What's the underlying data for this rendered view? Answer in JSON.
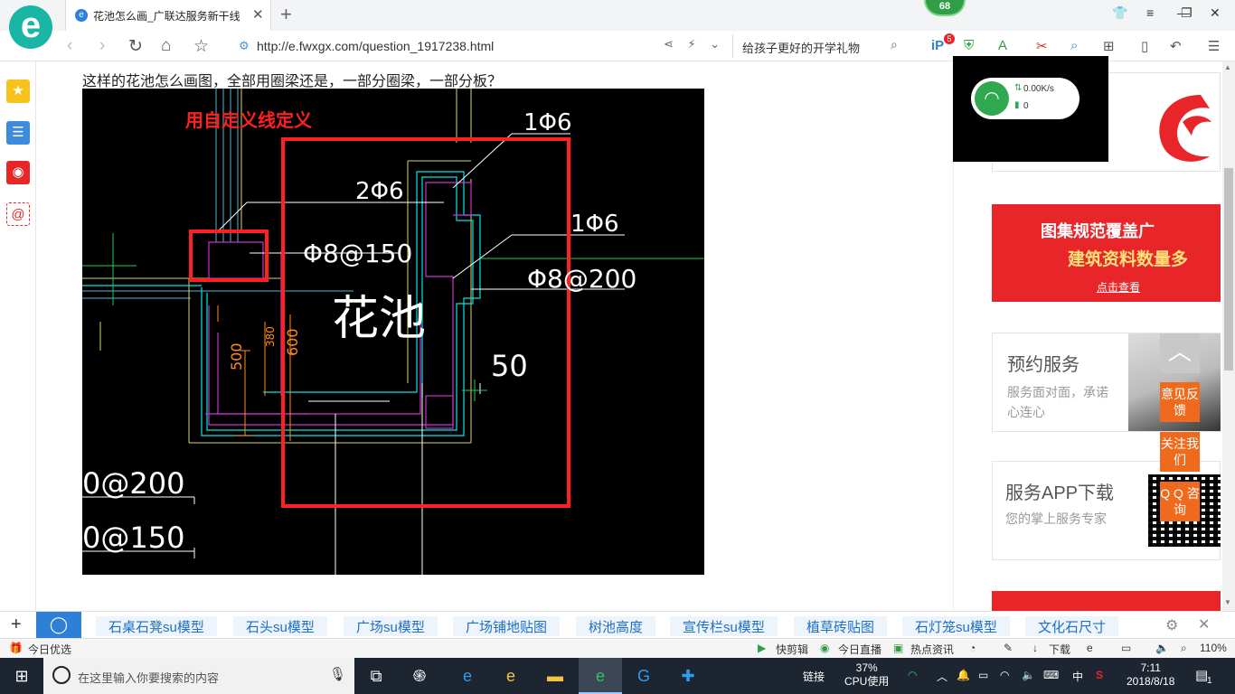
{
  "browser": {
    "tab_title": "花池怎么画_广联达服务新干线",
    "tab_favicon": "e",
    "logo_letter": "e",
    "badge_count": "68",
    "url": "http://e.fwxgx.com/question_1917238.html",
    "search_text": "给孩子更好的开学礼物",
    "extension_badge": "5"
  },
  "question": {
    "text": "这样的花池怎么画图，全部用圈梁还是，一部分圈梁，一部分板？"
  },
  "cad_drawing": {
    "annotation_red": "用自定义线定义",
    "label_1phi6_top": "1Φ6",
    "label_2phi6": "2Φ6",
    "label_1phi6_right": "1Φ6",
    "label_phi8_150": "Φ8@150",
    "label_phi8_200": "Φ8@200",
    "label_huachi": "花池",
    "label_50": "50",
    "label_500": "500",
    "label_380": "380",
    "label_600": "600",
    "label_bottom_1": "0@200",
    "label_bottom_2": "0@150"
  },
  "network_widget": {
    "speed": "0.00K/s",
    "count": "0"
  },
  "right_panel": {
    "banner_line1": "图集规范覆盖广",
    "banner_line2": "建筑资料数量多",
    "banner_link": "点击查看",
    "service_title": "预约服务",
    "service_desc": "服务面对面，承诺心连心",
    "app_title": "服务APP下载",
    "app_desc": "您的掌上服务专家",
    "feedback": "意见反馈",
    "follow": "关注我们",
    "qq": "Q Q 咨询"
  },
  "hot_links": [
    "石桌石凳su模型",
    "石头su模型",
    "广场su模型",
    "广场铺地贴图",
    "树池高度",
    "宣传栏su模型",
    "植草砖贴图",
    "石灯笼su模型",
    "文化石尺寸"
  ],
  "status_bar": {
    "left": "今日优选",
    "kuaijianji": "快剪辑",
    "live": "今日直播",
    "hotnews": "热点资讯",
    "download": "下载",
    "zoom": "110%"
  },
  "taskbar": {
    "search_placeholder": "在这里输入你要搜索的内容",
    "link_label": "链接",
    "cpu_percent": "37%",
    "cpu_label": "CPU使用",
    "ime": "中",
    "time": "7:11",
    "date": "2018/8/18",
    "notification_count": "1"
  },
  "colors": {
    "accent_blue": "#2e7fd6",
    "brand_red": "#e8262a",
    "orange": "#f06a1e",
    "logo_teal": "#19b5a5"
  }
}
